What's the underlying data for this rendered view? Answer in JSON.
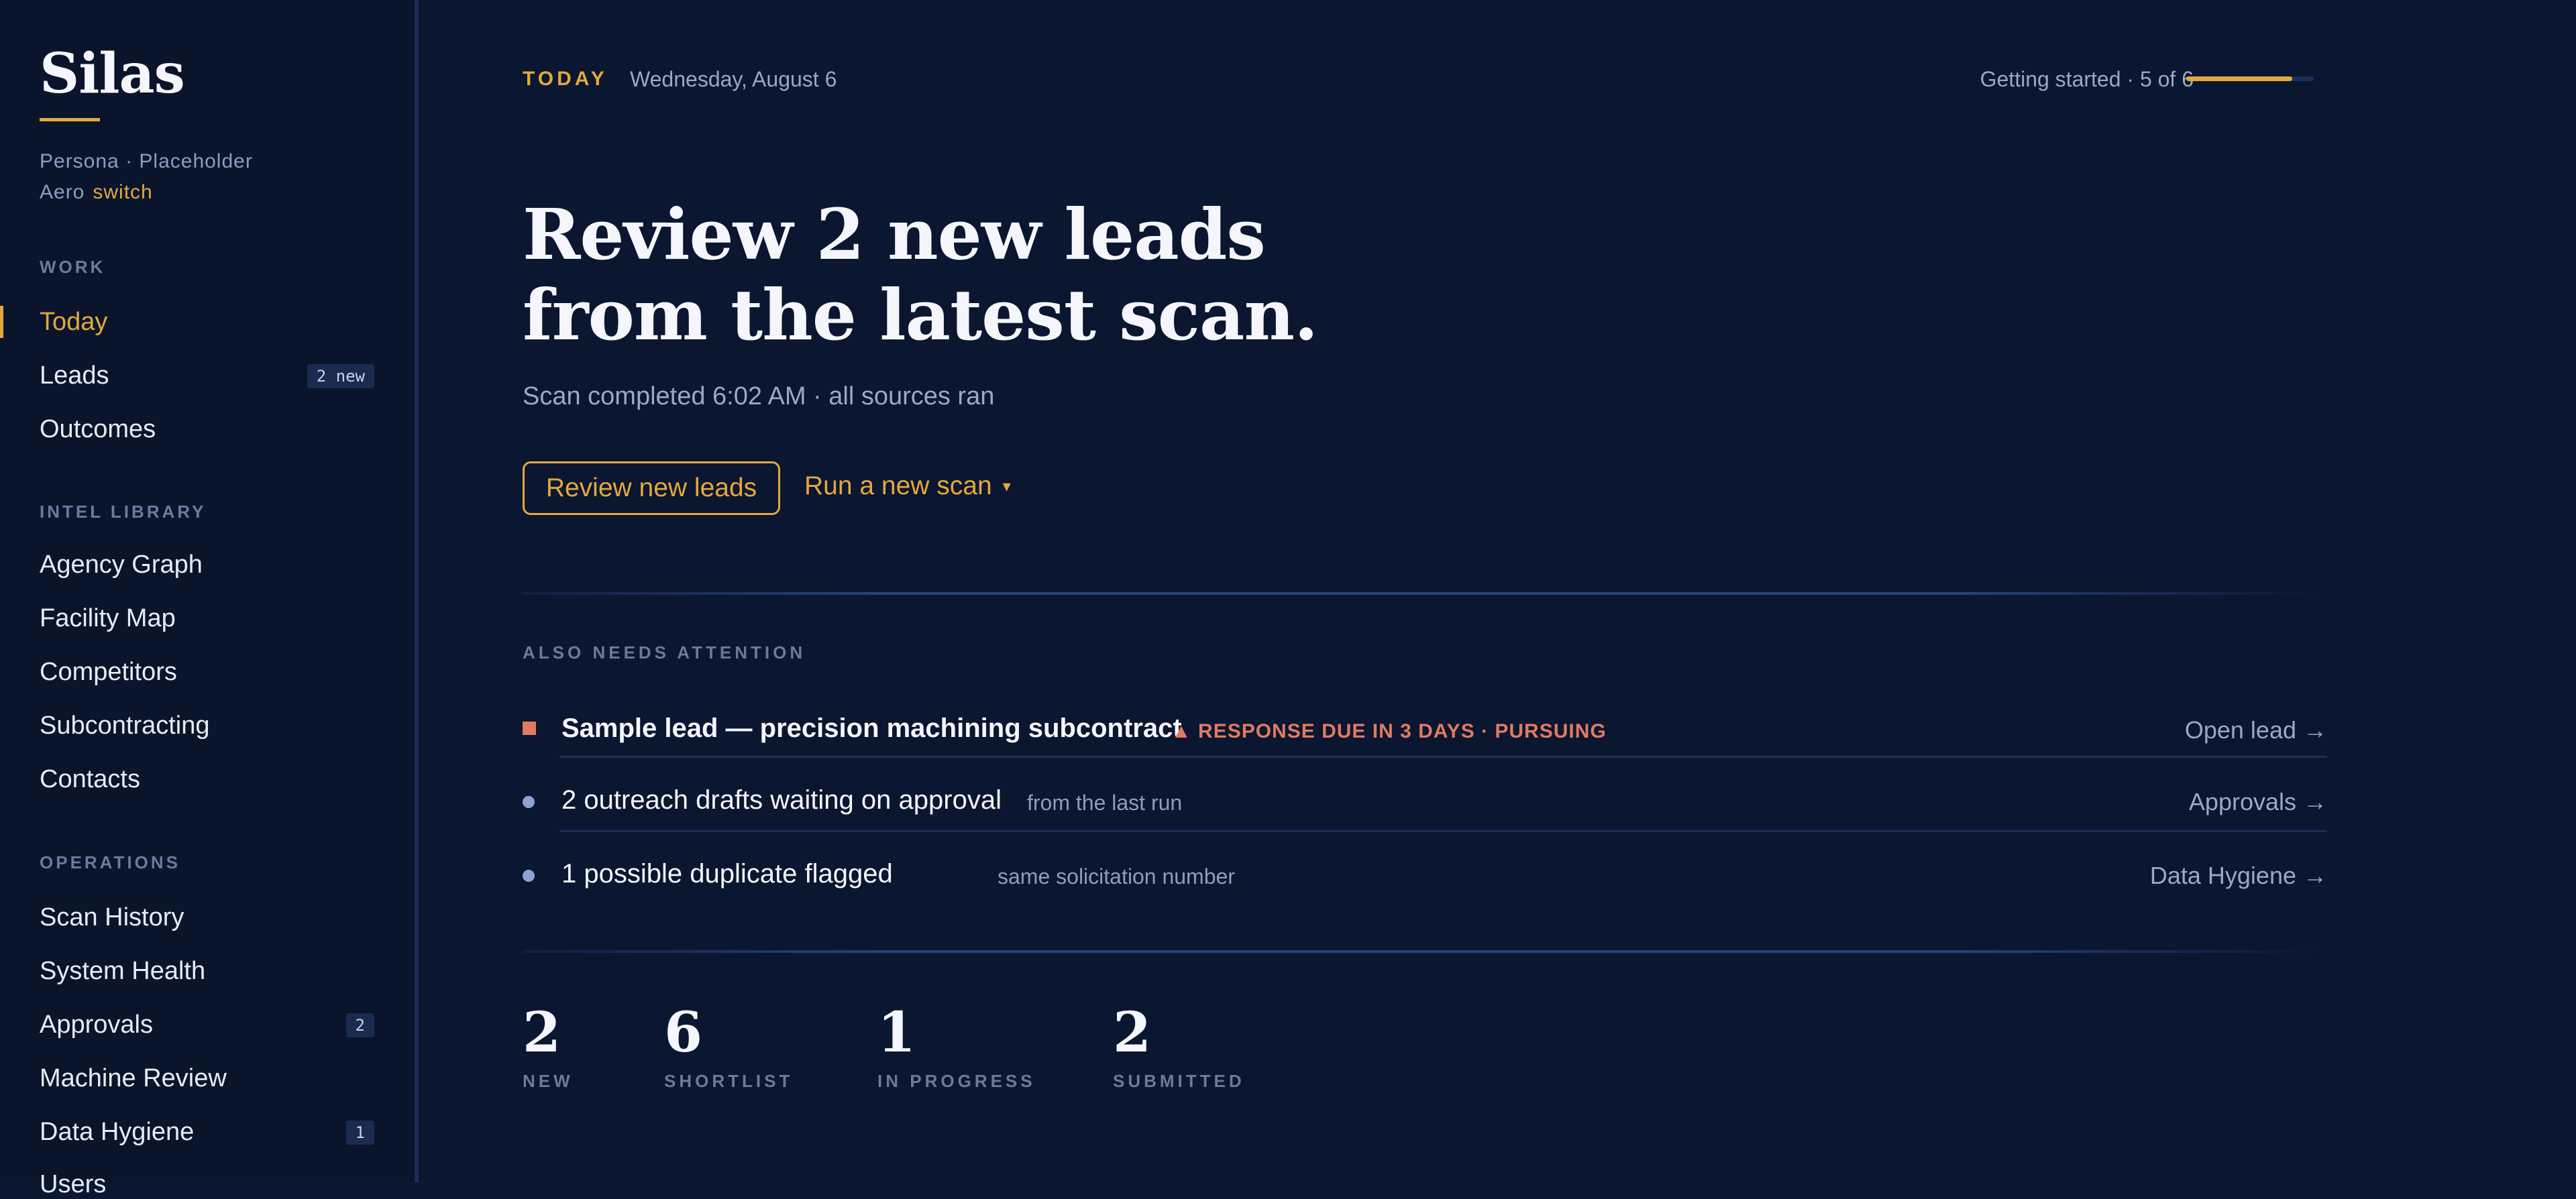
{
  "sidebar": {
    "brand": "Silas",
    "persona_line": "Persona · Placeholder",
    "persona_name": "Aero",
    "switch_label": "switch",
    "sections": {
      "work": "WORK",
      "intel": "INTEL LIBRARY",
      "operations": "OPERATIONS"
    },
    "work_items": [
      {
        "label": "Today",
        "active": true
      },
      {
        "label": "Leads",
        "badge": "2 new"
      },
      {
        "label": "Outcomes"
      }
    ],
    "intel_items": [
      {
        "label": "Agency Graph"
      },
      {
        "label": "Facility Map"
      },
      {
        "label": "Competitors"
      },
      {
        "label": "Subcontracting"
      },
      {
        "label": "Contacts"
      }
    ],
    "ops_items": [
      {
        "label": "Scan History"
      },
      {
        "label": "System Health"
      },
      {
        "label": "Approvals",
        "badge": "2"
      },
      {
        "label": "Machine Review"
      },
      {
        "label": "Data Hygiene",
        "badge": "1"
      },
      {
        "label": "Users"
      }
    ]
  },
  "header": {
    "today_label": "TODAY",
    "date": "Wednesday, August 6",
    "progress_text": "Getting started · 5 of 6",
    "progress_fraction": 0.833
  },
  "hero": {
    "headline": "Review 2 new leads from the latest scan.",
    "subline": "Scan completed 6:02 AM · all sources ran",
    "primary_button": "Review new leads",
    "secondary_button": "Run a new scan",
    "secondary_caret": "▾"
  },
  "attention": {
    "label": "ALSO NEEDS ATTENTION",
    "rows": [
      {
        "title": "Sample lead — precision machining subcontract",
        "warning": "▲ RESPONSE DUE IN 3 DAYS · PURSUING",
        "link": "Open lead →"
      },
      {
        "title": "2 outreach drafts waiting on approval",
        "meta": "from the last run",
        "link": "Approvals →"
      },
      {
        "title": "1 possible duplicate flagged",
        "meta": "same solicitation number",
        "link": "Data Hygiene →"
      }
    ]
  },
  "stats": [
    {
      "value": "2",
      "label": "NEW"
    },
    {
      "value": "6",
      "label": "SHORTLIST"
    },
    {
      "value": "1",
      "label": "IN PROGRESS"
    },
    {
      "value": "2",
      "label": "SUBMITTED"
    }
  ],
  "colors": {
    "accent": "#e3a93b",
    "warning": "#e07a63",
    "background": "#0b1630"
  }
}
